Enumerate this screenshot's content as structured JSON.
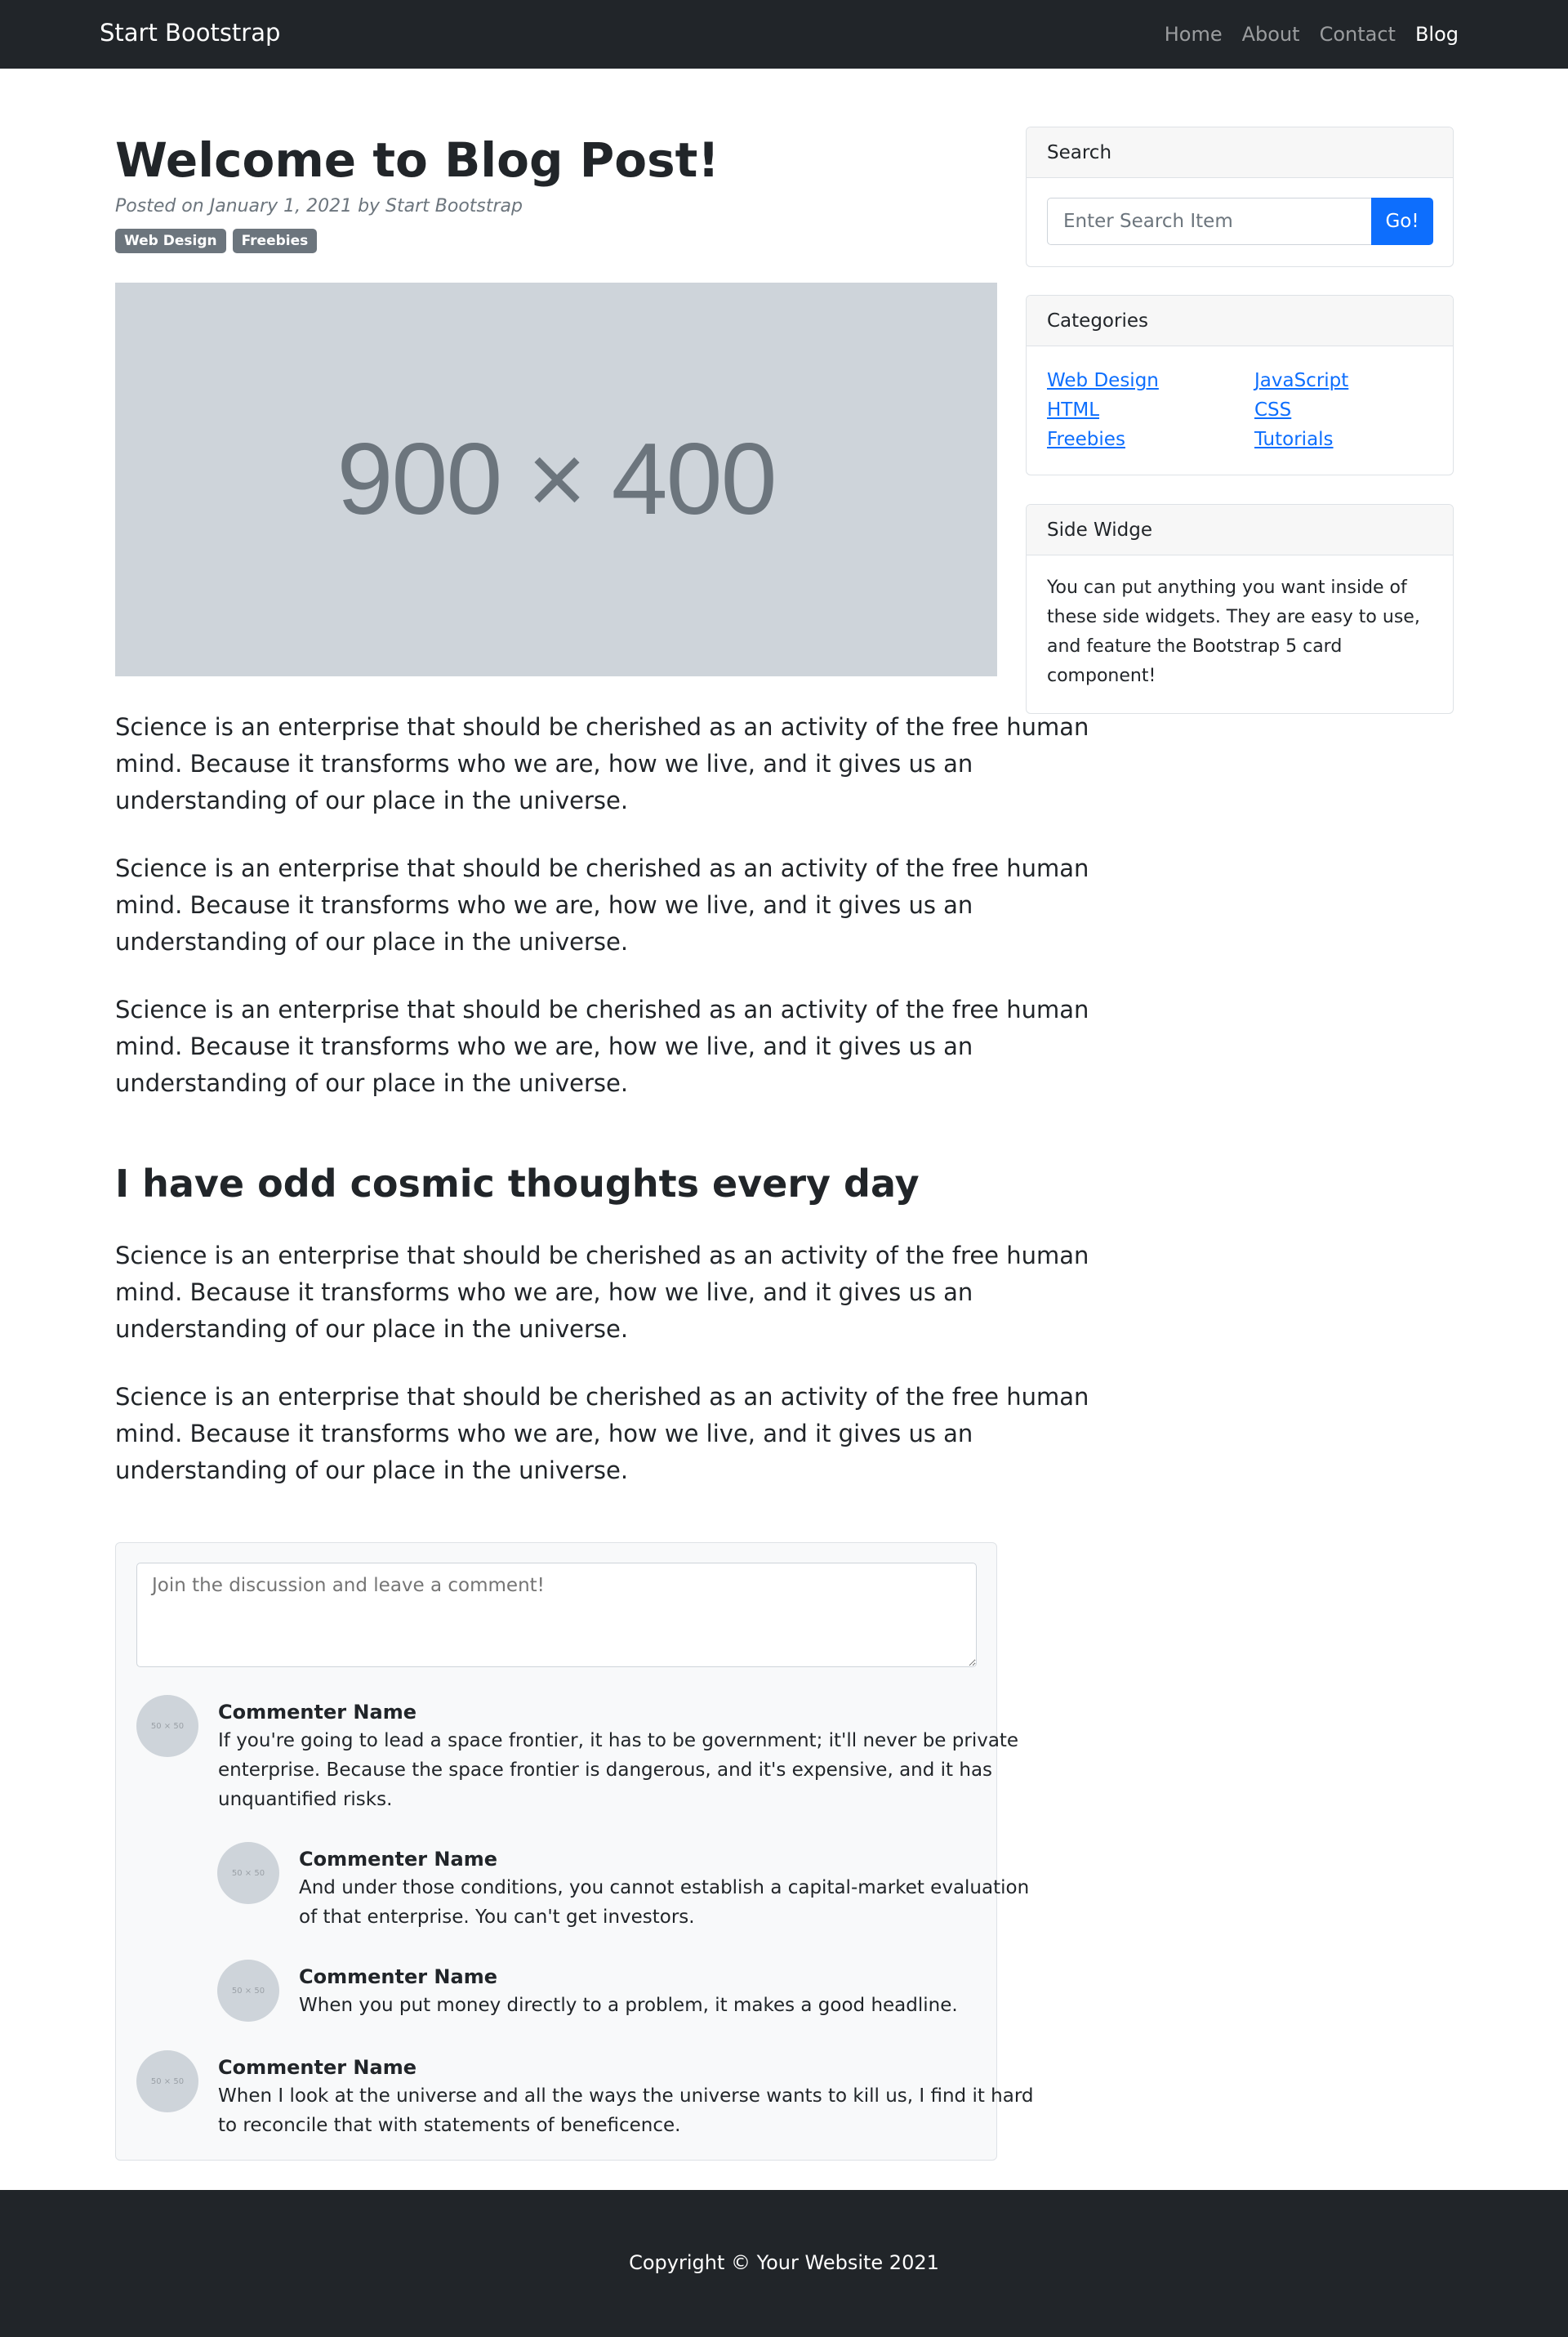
{
  "navbar": {
    "brand": "Start Bootstrap",
    "links": [
      {
        "label": "Home",
        "active": false
      },
      {
        "label": "About",
        "active": false
      },
      {
        "label": "Contact",
        "active": false
      },
      {
        "label": "Blog",
        "active": true
      }
    ]
  },
  "post": {
    "title": "Welcome to Blog Post!",
    "meta": "Posted on January 1, 2021 by Start Bootstrap",
    "tags": [
      "Web Design",
      "Freebies"
    ],
    "hero_placeholder": "900 × 400",
    "paragraphs_top": [
      [
        "Science is an enterprise that should be cherished as an activity of the free human",
        "mind. Because it transforms who we are, how we live, and it gives us an",
        "understanding of our place in the universe."
      ],
      [
        "Science is an enterprise that should be cherished as an activity of the free human",
        "mind. Because it transforms who we are, how we live, and it gives us an",
        "understanding of our place in the universe."
      ],
      [
        "Science is an enterprise that should be cherished as an activity of the free human",
        "mind. Because it transforms who we are, how we live, and it gives us an",
        "understanding of our place in the universe."
      ]
    ],
    "section_heading": "I have odd cosmic thoughts every day",
    "paragraphs_bottom": [
      [
        "Science is an enterprise that should be cherished as an activity of the free human",
        "mind. Because it transforms who we are, how we live, and it gives us an",
        "understanding of our place in the universe."
      ],
      [
        "Science is an enterprise that should be cherished as an activity of the free human",
        "mind. Because it transforms who we are, how we live, and it gives us an",
        "understanding of our place in the universe."
      ]
    ]
  },
  "comments": {
    "placeholder": "Join the discussion and leave a comment!",
    "avatar_label": "50 × 50",
    "items": [
      {
        "name": "Commenter Name",
        "lines": [
          "If you're going to lead a space frontier, it has to be government; it'll never be private",
          "enterprise. Because the space frontier is dangerous, and it's expensive, and it has",
          "unquantified risks."
        ]
      },
      {
        "name": "Commenter Name",
        "lines": [
          "And under those conditions, you cannot establish a capital-market evaluation",
          "of that enterprise. You can't get investors."
        ]
      },
      {
        "name": "Commenter Name",
        "lines": [
          "When you put money directly to a problem, it makes a good headline."
        ]
      },
      {
        "name": "Commenter Name",
        "lines": [
          "When I look at the universe and all the ways the universe wants to kill us, I find it hard",
          "to reconcile that with statements of beneficence."
        ]
      }
    ]
  },
  "sidebar": {
    "search": {
      "header": "Search",
      "placeholder": "Enter Search Item",
      "button": "Go!"
    },
    "categories": {
      "header": "Categories",
      "items": [
        "Web Design",
        "JavaScript",
        "HTML",
        "CSS",
        "Freebies",
        "Tutorials"
      ]
    },
    "widget": {
      "header": "Side Widge",
      "lines": [
        "You can put anything you want inside of",
        "these side widgets. They are easy to use,",
        "and feature the Bootstrap 5 card",
        "component!"
      ]
    }
  },
  "footer": {
    "copyright": "Copyright © Your Website 2021"
  },
  "colors": {
    "navbar": "#212529",
    "primary": "#0d6efd",
    "badge": "#6c757d",
    "placeholder_bg": "#ced4da"
  }
}
